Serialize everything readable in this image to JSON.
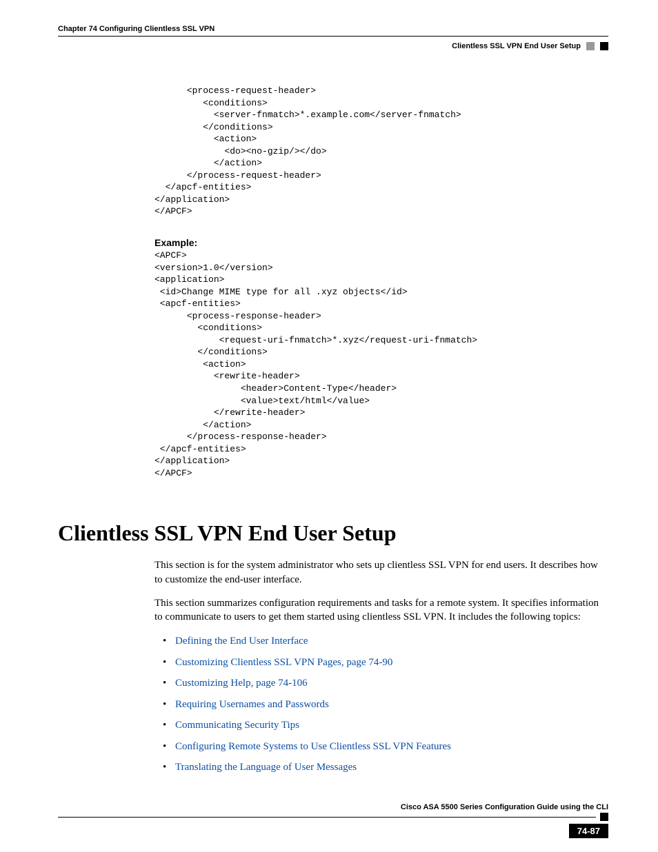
{
  "header": {
    "chapter": "Chapter 74    Configuring Clientless SSL VPN",
    "section": "Clientless SSL VPN End User Setup"
  },
  "code1": "      <process-request-header>\n         <conditions>\n           <server-fnmatch>*.example.com</server-fnmatch>\n         </conditions>\n           <action>\n             <do><no-gzip/></do>\n           </action>\n      </process-request-header>\n  </apcf-entities>\n</application>\n</APCF>",
  "example_label": "Example:",
  "code2": "<APCF>\n<version>1.0</version>\n<application>\n <id>Change MIME type for all .xyz objects</id>\n <apcf-entities>\n      <process-response-header>\n        <conditions>\n            <request-uri-fnmatch>*.xyz</request-uri-fnmatch>\n        </conditions>\n         <action>\n           <rewrite-header>\n                <header>Content-Type</header>\n                <value>text/html</value>\n           </rewrite-header>\n         </action>\n      </process-response-header>\n </apcf-entities>\n</application>\n</APCF>",
  "title": "Clientless SSL VPN End User Setup",
  "para1": "This section is for the system administrator who sets up clientless SSL VPN for end users. It describes how to customize the end-user interface.",
  "para2": "This section summarizes configuration requirements and tasks for a remote system. It specifies information to communicate to users to get them started using clientless SSL VPN. It includes the following topics:",
  "links": {
    "l1": "Defining the End User Interface",
    "l2": "Customizing Clientless SSL VPN Pages, page 74-90",
    "l3": "Customizing Help, page 74-106",
    "l4": "Requiring Usernames and Passwords",
    "l5": "Communicating Security Tips",
    "l6": "Configuring Remote Systems to Use Clientless SSL VPN Features",
    "l7": "Translating the Language of User Messages"
  },
  "footer": {
    "guide": "Cisco ASA 5500 Series Configuration Guide using the CLI",
    "page": "74-87"
  }
}
